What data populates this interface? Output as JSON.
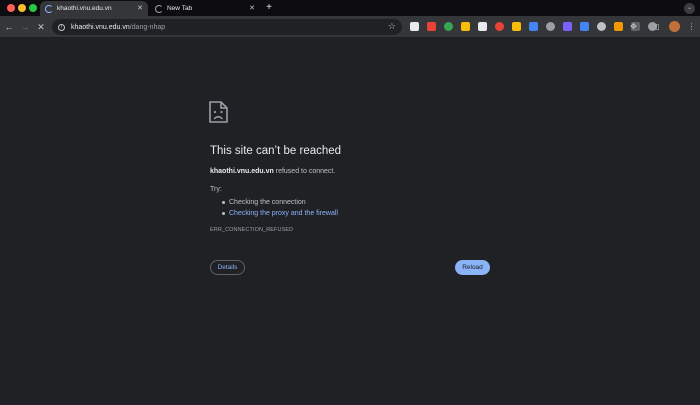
{
  "tabs": [
    {
      "title": "khaothi.vnu.edu.vn",
      "active": true,
      "loading": true
    },
    {
      "title": "New Tab",
      "active": false,
      "loading": true
    }
  ],
  "new_tab_label": "+",
  "toolbar": {
    "url_host": "khaothi.vnu.edu.vn",
    "url_path": "/dang-nhap",
    "icons": [
      "back-arrow-icon",
      "forward-arrow-icon",
      "stop-loading-icon",
      "site-info-icon",
      "bookmark-star-icon",
      "extensions-puzzle-icon",
      "side-panel-icon",
      "profile-avatar-icon",
      "more-menu-icon"
    ]
  },
  "extensions": [
    {
      "name": "extension-icon-1",
      "color": "#e8eaed"
    },
    {
      "name": "extension-icon-2",
      "color": "#ea4335"
    },
    {
      "name": "extension-icon-3",
      "color": "#34a853"
    },
    {
      "name": "extension-icon-4",
      "color": "#fbbc04"
    },
    {
      "name": "extension-icon-5",
      "color": "#e8eaed"
    },
    {
      "name": "extension-icon-6",
      "color": "#ea4335"
    },
    {
      "name": "extension-icon-7",
      "color": "#fbbc04"
    },
    {
      "name": "extension-icon-8",
      "color": "#4285f4"
    },
    {
      "name": "extension-icon-9",
      "color": "#9aa0a6"
    },
    {
      "name": "extension-icon-10",
      "color": "#7b61ff"
    },
    {
      "name": "extension-icon-11",
      "color": "#4285f4"
    },
    {
      "name": "extension-icon-12",
      "color": "#bdc1c6"
    },
    {
      "name": "extension-icon-13",
      "color": "#f29900"
    },
    {
      "name": "extension-icon-14",
      "color": "#5f6368"
    },
    {
      "name": "extension-icon-15",
      "color": "#9aa0a6"
    }
  ],
  "error_page": {
    "title": "This site can’t be reached",
    "host": "khaothi.vnu.edu.vn",
    "message": " refused to connect.",
    "try_label": "Try:",
    "suggestions": [
      {
        "text": "Checking the connection",
        "is_link": false
      },
      {
        "text": "Checking the proxy and the firewall",
        "is_link": true
      }
    ],
    "error_code": "ERR_CONNECTION_REFUSED",
    "details_button": "Details",
    "reload_button": "Reload"
  },
  "colors": {
    "page_bg": "#202124",
    "link": "#8ab4f8",
    "reload_bg": "#8ab4f8"
  }
}
